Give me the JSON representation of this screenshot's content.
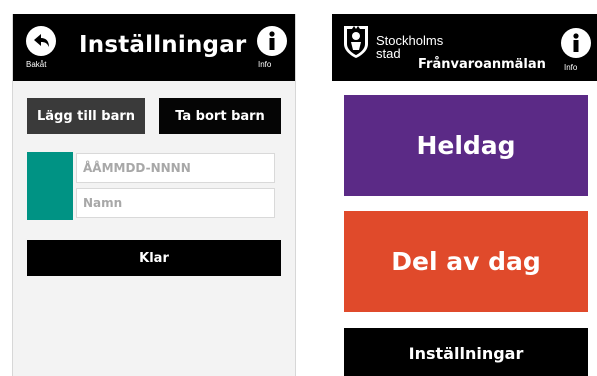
{
  "left_screen": {
    "header": {
      "title": "Inställningar",
      "back_label": "Bakåt",
      "info_label": "Info",
      "back_icon": "arrow-back-circle-icon",
      "info_icon": "info-circle-icon"
    },
    "buttons": {
      "add_child": "Lägg till barn",
      "remove_child": "Ta bort barn",
      "done": "Klar"
    },
    "fields": {
      "personal_number_placeholder": "ÅÅMMDD-NNNN",
      "name_placeholder": "Namn"
    },
    "colors": {
      "child_marker": "#009384"
    }
  },
  "right_screen": {
    "header": {
      "brand_line1": "Stockholms",
      "brand_line2": "stad",
      "app_title": "Frånvaroanmälan",
      "info_label": "Info",
      "logo_icon": "stockholm-crest-icon",
      "info_icon": "info-circle-icon"
    },
    "buttons": [
      {
        "label": "Heldag",
        "color": "#5b2a86"
      },
      {
        "label": "Del av dag",
        "color": "#e04a2b"
      },
      {
        "label": "Inställningar",
        "color": "#000000"
      }
    ]
  }
}
